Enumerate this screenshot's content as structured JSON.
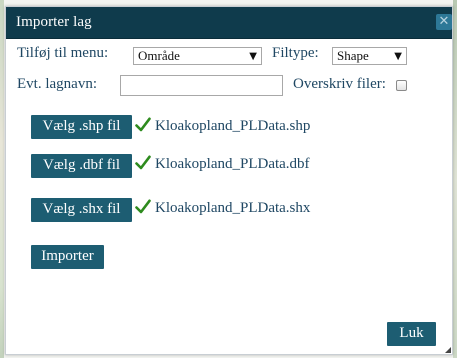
{
  "dialog": {
    "title": "Importer lag",
    "close_glyph": "✕",
    "close_icon": "close-icon"
  },
  "form": {
    "menu_label": "Tilføj til menu:",
    "menu_value": "Område",
    "filetype_label": "Filtype:",
    "filetype_value": "Shape",
    "layername_label": "Evt. lagnavn:",
    "layername_value": "",
    "overwrite_label": "Overskriv filer:",
    "overwrite_checked": false
  },
  "files": [
    {
      "button_label": "Vælg .shp fil",
      "filename": "Kloakopland_PLData.shp",
      "status_icon": "checkmark-icon"
    },
    {
      "button_label": "Vælg .dbf fil",
      "filename": "Kloakopland_PLData.dbf",
      "status_icon": "checkmark-icon"
    },
    {
      "button_label": "Vælg .shx fil",
      "filename": "Kloakopland_PLData.shx",
      "status_icon": "checkmark-icon"
    }
  ],
  "actions": {
    "import_label": "Importer",
    "close_label": "Luk"
  },
  "colors": {
    "titlebar": "#0f3b4c",
    "button": "#1d5d72",
    "check": "#2e8b1e",
    "label_text": "#1f4763"
  }
}
